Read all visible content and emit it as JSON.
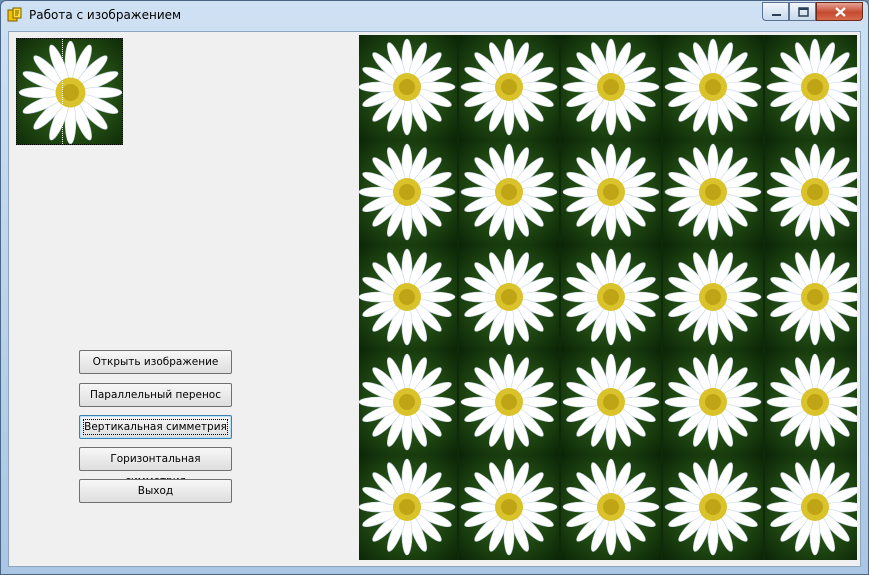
{
  "window": {
    "title": "Работа с изображением"
  },
  "buttons": {
    "open": "Открыть изображение",
    "translate": "Параллельный перенос",
    "vertical": "Вертикальная симметрия",
    "horizontal": "Горизонтальная симметрия",
    "exit": "Выход"
  },
  "colors": {
    "petal": "#ffffff",
    "center": "#d9c22a",
    "leaf": "#1f4a12"
  }
}
